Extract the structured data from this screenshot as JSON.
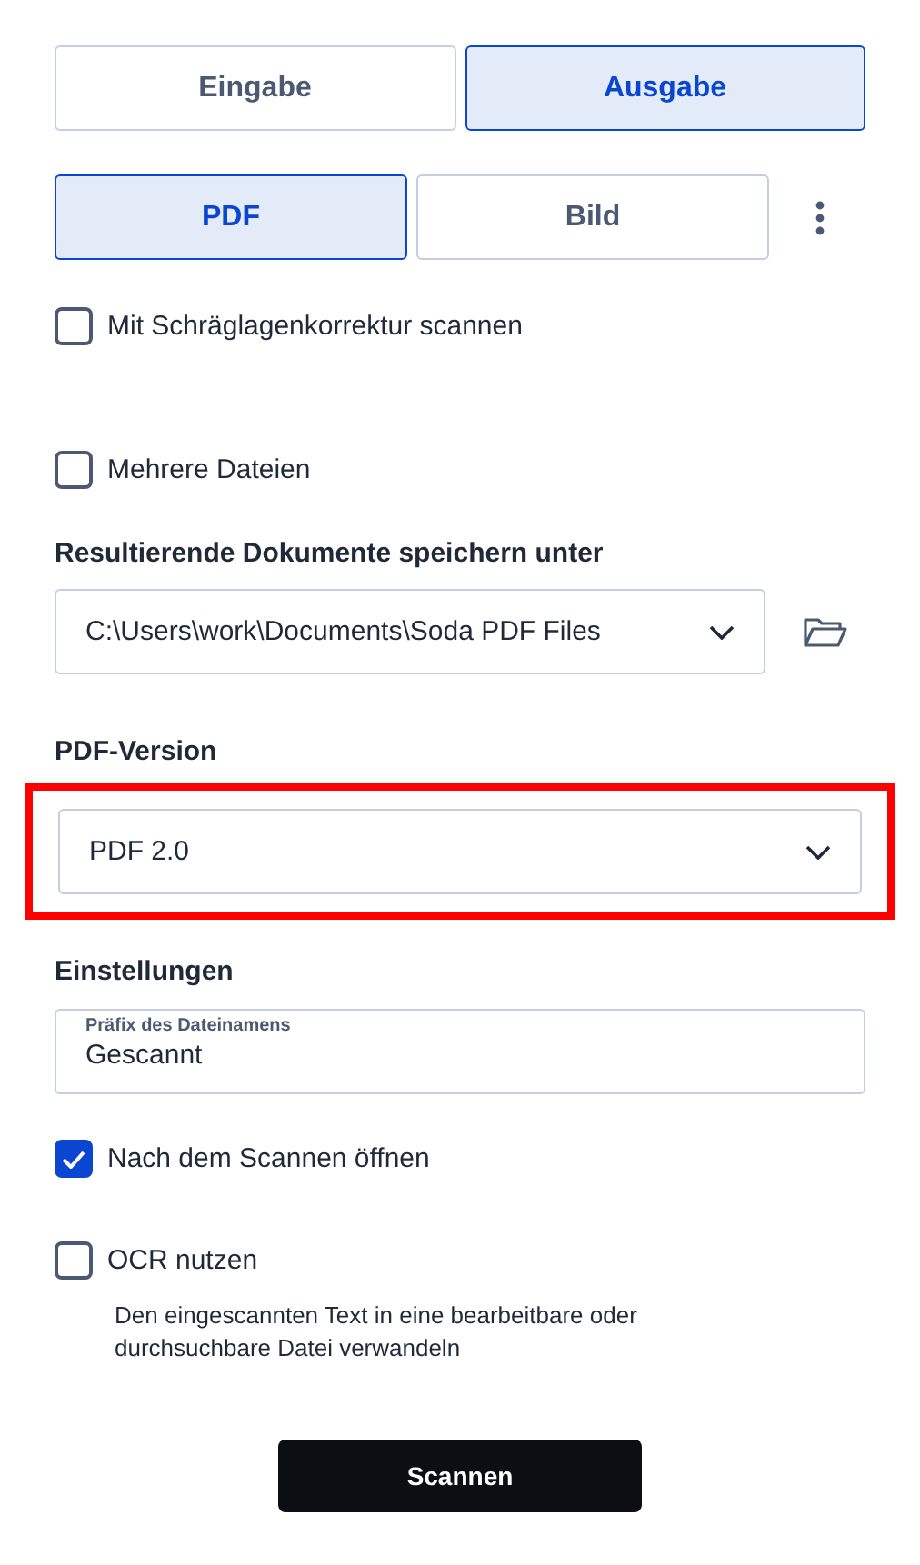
{
  "tabs": [
    {
      "label": "Eingabe",
      "selected": false
    },
    {
      "label": "Ausgabe",
      "selected": true
    }
  ],
  "formats": [
    {
      "label": "PDF",
      "selected": true
    },
    {
      "label": "Bild",
      "selected": false
    }
  ],
  "options_top": [
    {
      "label": "Mit Schräglagenkorrektur scannen",
      "checked": false
    },
    {
      "label": "Mehrere Dateien",
      "checked": false
    }
  ],
  "save_location": {
    "label": "Resultierende Dokumente speichern unter",
    "value": "C:\\Users\\work\\Documents\\Soda PDF Files"
  },
  "pdf_version": {
    "label": "PDF-Version",
    "value": "PDF 2.0",
    "highlighted": true
  },
  "settings": {
    "label": "Einstellungen",
    "prefix_label": "Präfix des Dateinamens",
    "prefix_value": "Gescannt"
  },
  "options_bottom": [
    {
      "label": "Nach dem Scannen öffnen",
      "checked": true
    },
    {
      "label": "OCR nutzen",
      "checked": false,
      "description": "Den eingescannten Text in eine bearbeitbare oder durchsuchbare Datei verwandeln"
    }
  ],
  "scan_button": "Scannen"
}
